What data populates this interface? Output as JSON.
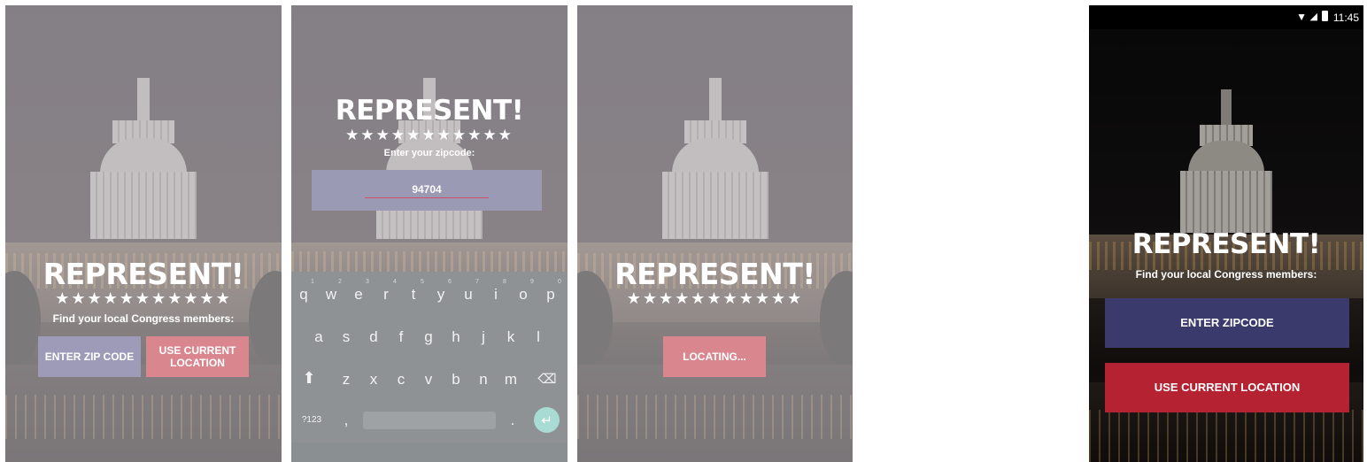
{
  "screen1": {
    "title": "REPRESENT!",
    "stars": "★★★★★★★★★★★",
    "subtitle": "Find your local Congress members:",
    "zip_button": "ENTER ZIP CODE",
    "location_button": "USE CURRENT LOCATION"
  },
  "screen2": {
    "title": "REPRESENT!",
    "stars": "★★★★★★★★★★★",
    "prompt": "Enter your zipcode:",
    "zip_value": "94704",
    "keyboard": {
      "row1": [
        "q",
        "w",
        "e",
        "r",
        "t",
        "y",
        "u",
        "i",
        "o",
        "p"
      ],
      "row1_hints": [
        "1",
        "2",
        "3",
        "4",
        "5",
        "6",
        "7",
        "8",
        "9",
        "0"
      ],
      "row2": [
        "a",
        "s",
        "d",
        "f",
        "g",
        "h",
        "j",
        "k",
        "l"
      ],
      "row3": [
        "z",
        "x",
        "c",
        "v",
        "b",
        "n",
        "m"
      ],
      "symbols": "?123",
      "comma": ",",
      "period": "."
    }
  },
  "screen3": {
    "title": "REPRESENT!",
    "stars": "★★★★★★★★★★★",
    "locating_button": "LOCATING..."
  },
  "screen4": {
    "status_time": "11:45",
    "title": "REPRESENT!",
    "subtitle": "Find your local Congress members:",
    "zip_button": "ENTER ZIPCODE",
    "location_button": "USE CURRENT LOCATION"
  },
  "colors": {
    "zip_button_light": "#9d9bb8",
    "location_button_light": "#d9868f",
    "zip_button_dark": "#3b3a6c",
    "location_button_dark": "#b52232",
    "keyboard_bg": "#8e9295",
    "enter_key": "#a7dbd3"
  }
}
